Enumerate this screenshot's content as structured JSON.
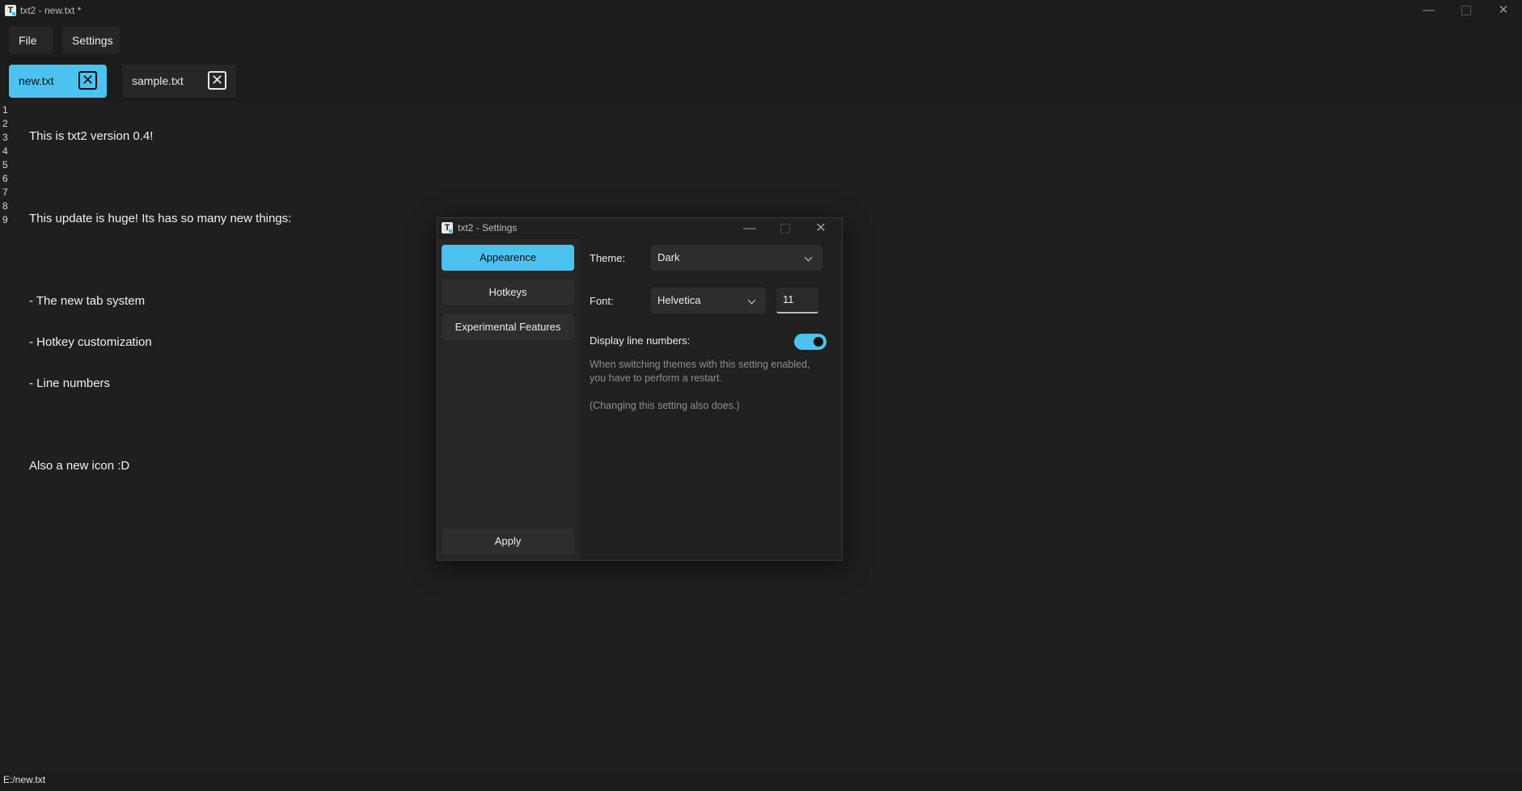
{
  "window": {
    "title": "txt2 - new.txt *",
    "app_icon_letter": "T",
    "minimize": "—",
    "close": "✕"
  },
  "menu": {
    "file_label": "File",
    "settings_label": "Settings"
  },
  "tabs": [
    {
      "label": "new.txt",
      "close": "✕"
    },
    {
      "label": "sample.txt",
      "close": "✕"
    }
  ],
  "editor": {
    "line_numbers": [
      "1",
      "2",
      "3",
      "4",
      "5",
      "6",
      "7",
      "8",
      "9"
    ],
    "lines": [
      "This is txt2 version 0.4!",
      "",
      "This update is huge! Its has so many new things:",
      "",
      "- The new tab system",
      "- Hotkey customization",
      "- Line numbers",
      "",
      "Also a new icon :D"
    ]
  },
  "status_bar": {
    "path": "E:/new.txt"
  },
  "settings_dialog": {
    "title": "txt2 - Settings",
    "minimize": "—",
    "close": "✕",
    "sidebar": {
      "appearance": "Appearence",
      "hotkeys": "Hotkeys",
      "experimental": "Experimental Features",
      "apply": "Apply"
    },
    "theme_label": "Theme:",
    "theme_value": "Dark",
    "font_label": "Font:",
    "font_value": "Helvetica",
    "font_size": "11",
    "line_numbers_label": "Display line numbers:",
    "line_numbers_enabled": true,
    "note_line1": "When switching themes with this setting enabled,",
    "note_line2": "you have to perform a restart.",
    "note_line3": "(Changing this setting also does.)",
    "accent_color": "#4cc2f1"
  }
}
